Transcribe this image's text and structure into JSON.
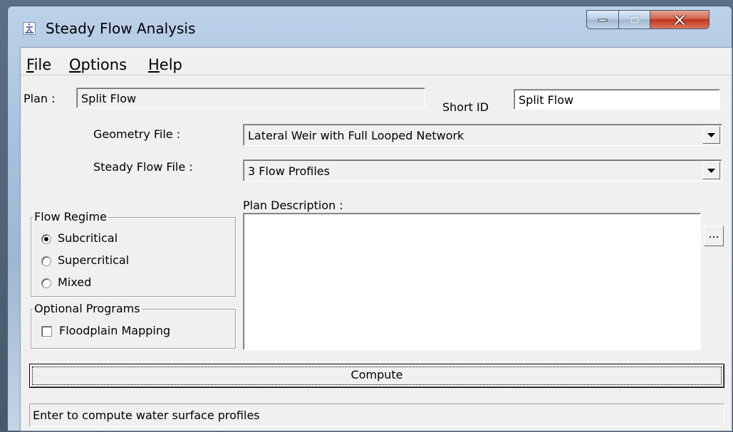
{
  "window": {
    "title": "Steady Flow Analysis",
    "icon": "hec-ras-app-icon",
    "controls": [
      "minimize-icon",
      "maximize-icon",
      "close-icon"
    ]
  },
  "menu": {
    "file": {
      "accel": "F",
      "rest": "ile"
    },
    "options": {
      "accel": "O",
      "rest": "ptions"
    },
    "help": {
      "accel": "H",
      "rest": "elp"
    }
  },
  "plan": {
    "label": "Plan :",
    "value": "Split Flow",
    "short_id_label": "Short ID",
    "short_id_value": "Split Flow"
  },
  "geometry": {
    "label": "Geometry File :",
    "value": "Lateral Weir with Full Looped Network"
  },
  "steady_flow": {
    "label": "Steady Flow File :",
    "value": "3 Flow Profiles"
  },
  "flow_regime": {
    "title": "Flow Regime",
    "options": [
      {
        "label": "Subcritical",
        "selected": true
      },
      {
        "label": "Supercritical",
        "selected": false
      },
      {
        "label": "Mixed",
        "selected": false
      }
    ]
  },
  "optional_programs": {
    "title": "Optional Programs",
    "floodplain_mapping_label": "Floodplain Mapping",
    "floodplain_mapping_checked": false
  },
  "plan_description": {
    "label": "Plan Description :",
    "value": "",
    "browse_label": "..."
  },
  "compute_label": "Compute",
  "status_text": "Enter to compute water surface profiles"
}
